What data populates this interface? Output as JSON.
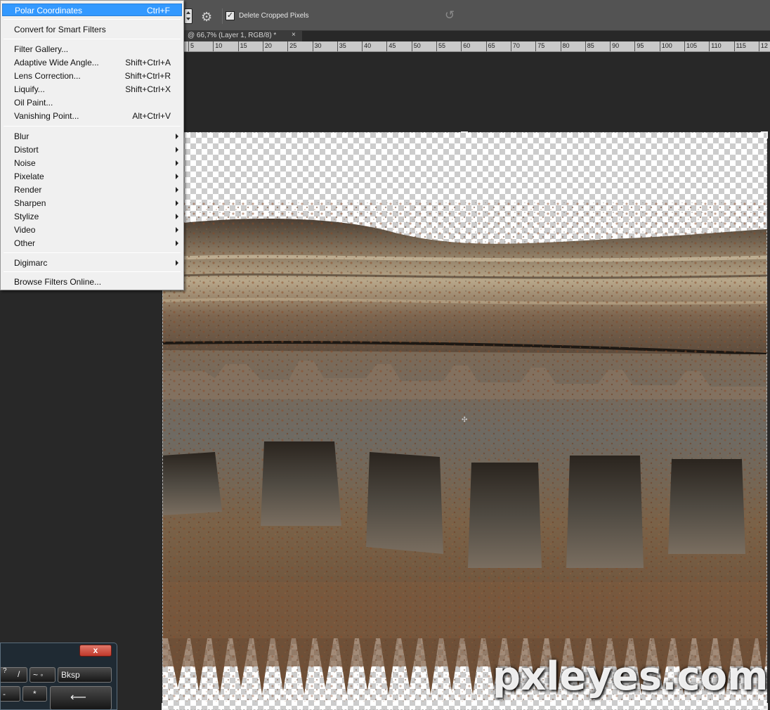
{
  "options_bar": {
    "delete_cropped_label": "Delete Cropped Pixels",
    "delete_cropped_checked": true,
    "checkbox_mark": "✓",
    "gear_glyph": "⚙",
    "reset_glyph": "↺"
  },
  "document_tab": {
    "label": "@ 66,7% (Layer 1, RGB/8) *",
    "close": "×"
  },
  "ruler": {
    "labels": [
      "5",
      "10",
      "15",
      "20",
      "25",
      "30",
      "35",
      "40",
      "45",
      "50",
      "55",
      "60",
      "65",
      "70",
      "75",
      "80",
      "85",
      "90",
      "95",
      "100",
      "105",
      "110",
      "115",
      "12"
    ]
  },
  "filter_menu": {
    "last_filter": {
      "label": "Polar Coordinates",
      "shortcut": "Ctrl+F"
    },
    "smart": {
      "label": "Convert for Smart Filters"
    },
    "tools": [
      {
        "label": "Filter Gallery...",
        "shortcut": ""
      },
      {
        "label": "Adaptive Wide Angle...",
        "shortcut": "Shift+Ctrl+A"
      },
      {
        "label": "Lens Correction...",
        "shortcut": "Shift+Ctrl+R"
      },
      {
        "label": "Liquify...",
        "shortcut": "Shift+Ctrl+X"
      },
      {
        "label": "Oil Paint...",
        "shortcut": ""
      },
      {
        "label": "Vanishing Point...",
        "shortcut": "Alt+Ctrl+V"
      }
    ],
    "submenus": [
      {
        "label": "Blur"
      },
      {
        "label": "Distort"
      },
      {
        "label": "Noise"
      },
      {
        "label": "Pixelate"
      },
      {
        "label": "Render"
      },
      {
        "label": "Sharpen"
      },
      {
        "label": "Stylize"
      },
      {
        "label": "Video"
      },
      {
        "label": "Other"
      }
    ],
    "digimarc": {
      "label": "Digimarc"
    },
    "browse": {
      "label": "Browse Filters Online..."
    }
  },
  "canvas": {
    "watermark": "pxleyes.com",
    "crosshair_glyph": "✣"
  },
  "keyboard": {
    "close": "x",
    "keys": [
      {
        "label": "?"
      },
      {
        "label": "/"
      },
      {
        "label": "~ ◦"
      },
      {
        "label": "Bksp"
      },
      {
        "label": "- "
      },
      {
        "label": "*"
      },
      {
        "label": "⟵"
      }
    ]
  },
  "colors": {
    "menu_highlight": "#3399ff",
    "panel_bg": "#535353",
    "workspace_bg": "#282828"
  }
}
